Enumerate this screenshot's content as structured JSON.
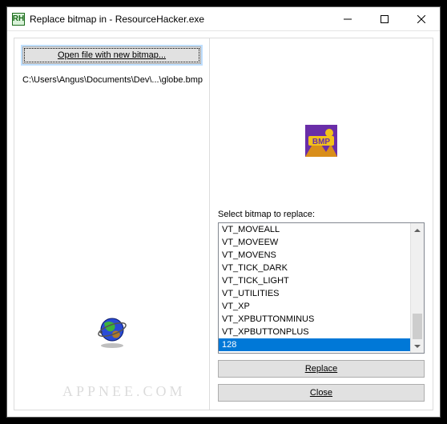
{
  "titlebar": {
    "app_icon_text": "RH",
    "title": "Replace bitmap in - ResourceHacker.exe"
  },
  "left": {
    "open_button": "Open file with new bitmap...",
    "filepath": "C:\\Users\\Angus\\Documents\\Dev\\...\\globe.bmp"
  },
  "right": {
    "bmp_label": "BMP",
    "select_label": "Select bitmap to replace:",
    "items": [
      "VT_MOVEALL",
      "VT_MOVEEW",
      "VT_MOVENS",
      "VT_TICK_DARK",
      "VT_TICK_LIGHT",
      "VT_UTILITIES",
      "VT_XP",
      "VT_XPBUTTONMINUS",
      "VT_XPBUTTONPLUS",
      "128"
    ],
    "selected_index": 9,
    "replace_button": "Replace",
    "close_button": "Close"
  },
  "watermark": "APPNEE.COM"
}
